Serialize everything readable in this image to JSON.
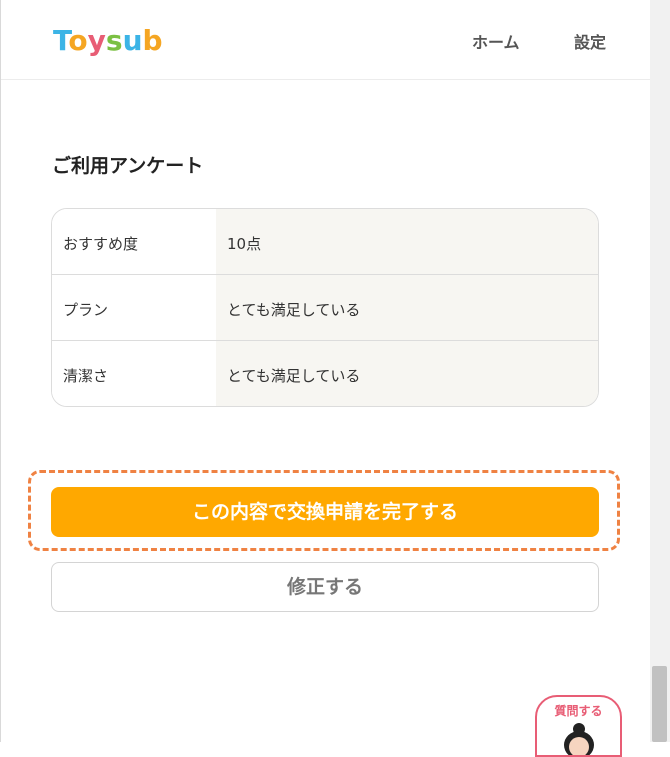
{
  "header": {
    "logo_text": "Toysub!",
    "nav": [
      {
        "label": "ホーム"
      },
      {
        "label": "設定"
      }
    ]
  },
  "survey": {
    "title": "ご利用アンケート",
    "rows": [
      {
        "label": "おすすめ度",
        "value": "10点"
      },
      {
        "label": "プラン",
        "value": "とても満足している"
      },
      {
        "label": "清潔さ",
        "value": "とても満足している"
      }
    ]
  },
  "actions": {
    "submit_label": "この内容で交換申請を完了する",
    "edit_label": "修正する"
  },
  "help": {
    "label": "質問する"
  },
  "colors": {
    "accent": "#ffa800",
    "focus_outline": "#ef8243",
    "help_accent": "#e85d75"
  }
}
